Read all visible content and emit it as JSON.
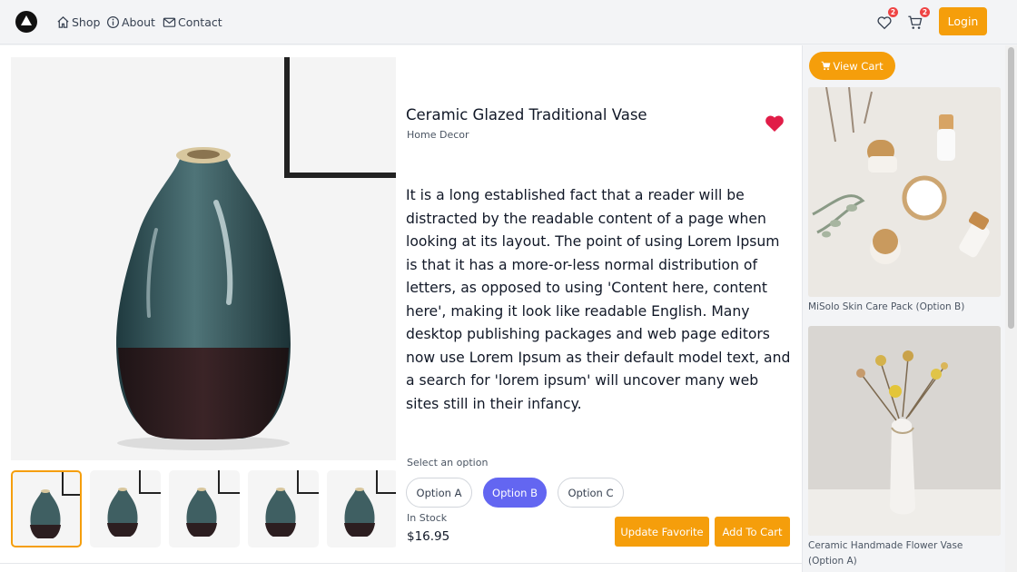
{
  "nav": {
    "links": [
      {
        "label": "Shop",
        "icon": "home-icon"
      },
      {
        "label": "About",
        "icon": "info-icon"
      },
      {
        "label": "Contact",
        "icon": "mail-icon"
      }
    ],
    "favorites_count": "2",
    "cart_count": "2",
    "login_label": "Login"
  },
  "product": {
    "title": "Ceramic Glazed Traditional Vase",
    "category": "Home Decor",
    "favorited": true,
    "description": "It is a long established fact that a reader will be distracted by the readable content of a page when looking at its layout. The point of using Lorem Ipsum is that it has a more-or-less normal distribution of letters, as opposed to using 'Content here, content here', making it look like readable English. Many desktop publishing packages and web page editors now use Lorem Ipsum as their default model text, and a search for 'lorem ipsum' will uncover many web sites still in their infancy.",
    "option_label": "Select an option",
    "options": [
      "Option A",
      "Option B",
      "Option C"
    ],
    "selected_option": "Option B",
    "stock": "In Stock",
    "price": "$16.95",
    "update_favorite_label": "Update Favorite",
    "add_to_cart_label": "Add To Cart"
  },
  "sidebar": {
    "view_cart_label": "View Cart",
    "items": [
      {
        "caption": "MiSolo Skin Care Pack (Option B)"
      },
      {
        "caption": "Ceramic Handmade Flower Vase (Option A)"
      }
    ]
  },
  "colors": {
    "accent": "#f59e0b",
    "selected_option": "#6366f1",
    "heart": "#e11d48",
    "badge": "#ef4444"
  }
}
